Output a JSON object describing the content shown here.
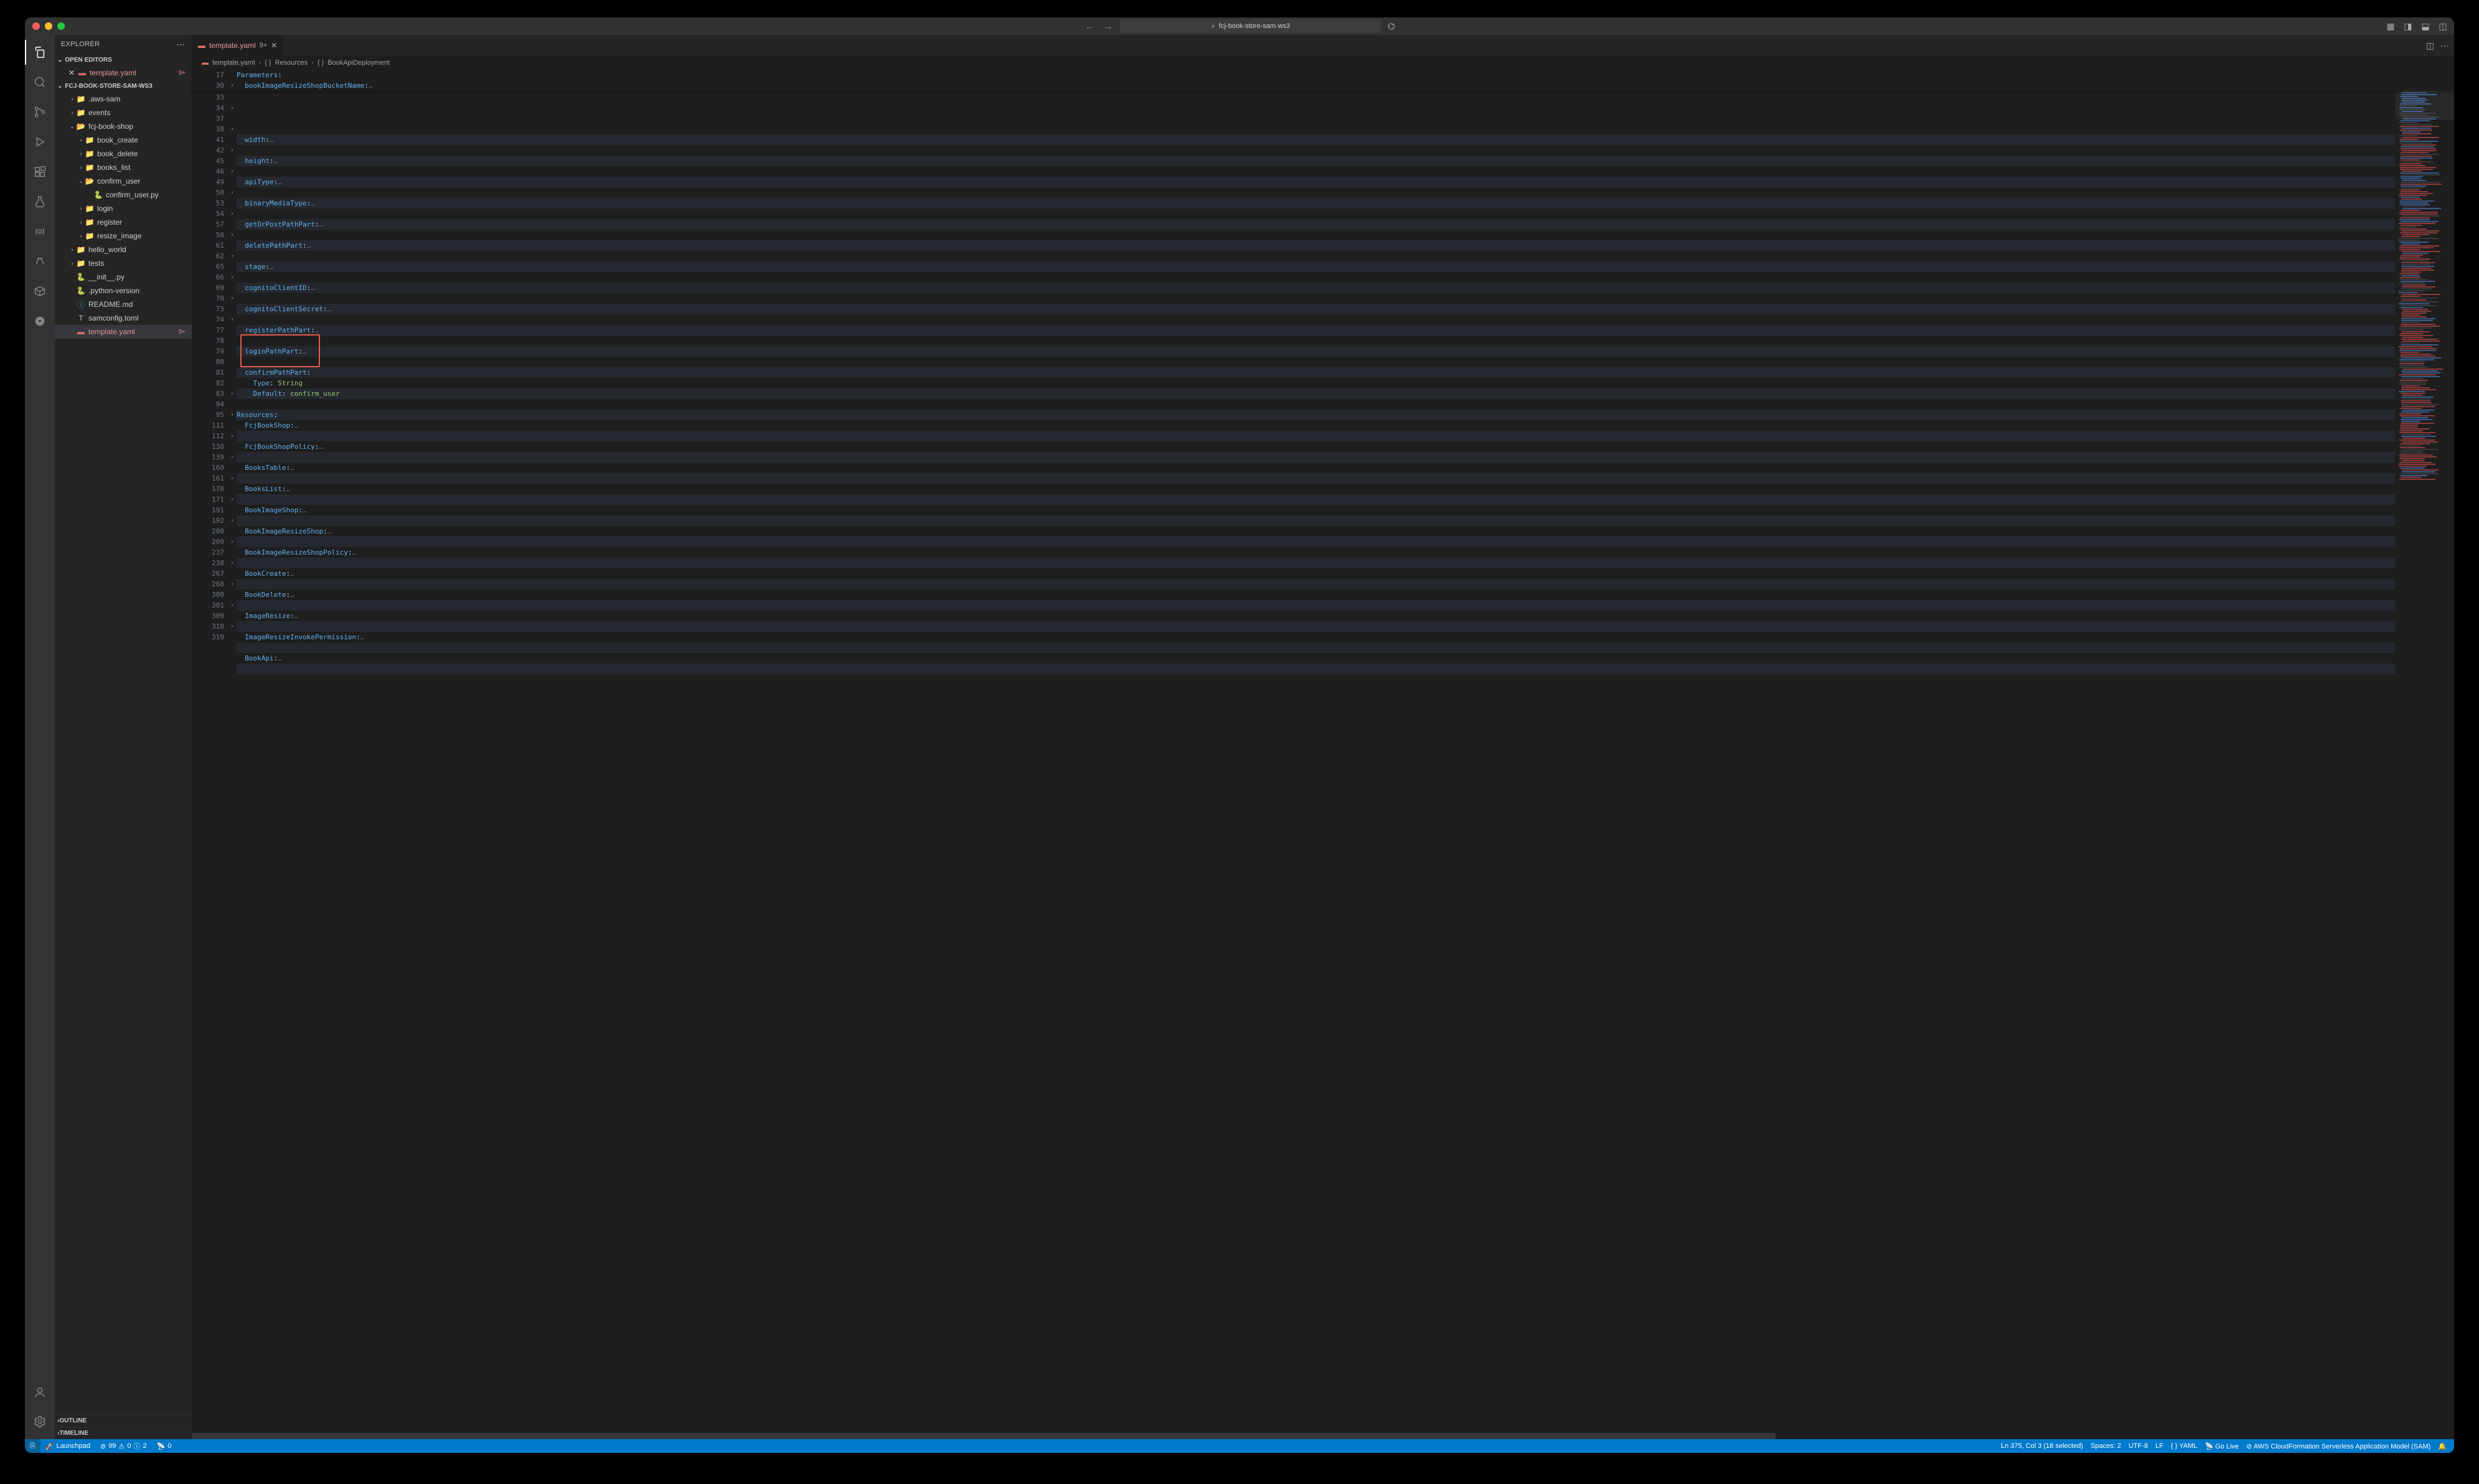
{
  "titlebar": {
    "search_text": "fcj-book-store-sam-ws3"
  },
  "sidebar": {
    "title": "EXPLORER",
    "open_editors_label": "OPEN EDITORS",
    "workspace_label": "FCJ-BOOK-STORE-SAM-WS3",
    "outline_label": "OUTLINE",
    "timeline_label": "TIMELINE",
    "open_editor": {
      "name": "template.yaml",
      "badge": "9+"
    },
    "tree": [
      {
        "depth": 1,
        "kind": "folder",
        "name": ".aws-sam",
        "tw": "›",
        "ico": "folder"
      },
      {
        "depth": 1,
        "kind": "folder",
        "name": "events",
        "tw": "›",
        "ico": "folder"
      },
      {
        "depth": 1,
        "kind": "folder",
        "name": "fcj-book-shop",
        "tw": "⌄",
        "ico": "folder-o"
      },
      {
        "depth": 2,
        "kind": "folder",
        "name": "book_create",
        "tw": "›",
        "ico": "folder"
      },
      {
        "depth": 2,
        "kind": "folder",
        "name": "book_delete",
        "tw": "›",
        "ico": "folder"
      },
      {
        "depth": 2,
        "kind": "folder",
        "name": "books_list",
        "tw": "›",
        "ico": "folder"
      },
      {
        "depth": 2,
        "kind": "folder",
        "name": "confirm_user",
        "tw": "⌄",
        "ico": "folder-o"
      },
      {
        "depth": 3,
        "kind": "file",
        "name": "confirm_user.py",
        "tw": "",
        "ico": "py"
      },
      {
        "depth": 2,
        "kind": "folder",
        "name": "login",
        "tw": "›",
        "ico": "folder"
      },
      {
        "depth": 2,
        "kind": "folder",
        "name": "register",
        "tw": "›",
        "ico": "folder"
      },
      {
        "depth": 2,
        "kind": "folder",
        "name": "resize_image",
        "tw": "›",
        "ico": "folder"
      },
      {
        "depth": 1,
        "kind": "folder",
        "name": "hello_world",
        "tw": "›",
        "ico": "folder"
      },
      {
        "depth": 1,
        "kind": "folder",
        "name": "tests",
        "tw": "›",
        "ico": "folder-teal"
      },
      {
        "depth": 1,
        "kind": "file",
        "name": "__init__.py",
        "tw": "",
        "ico": "py"
      },
      {
        "depth": 1,
        "kind": "file",
        "name": ".python-version",
        "tw": "",
        "ico": "py"
      },
      {
        "depth": 1,
        "kind": "file",
        "name": "README.md",
        "tw": "",
        "ico": "md"
      },
      {
        "depth": 1,
        "kind": "file",
        "name": "samconfig.toml",
        "tw": "",
        "ico": "toml"
      },
      {
        "depth": 1,
        "kind": "file",
        "name": "template.yaml",
        "tw": "",
        "ico": "yaml",
        "badge": "9+",
        "selected": true
      }
    ]
  },
  "tab": {
    "name": "template.yaml",
    "mod": "9+"
  },
  "breadcrumb": [
    {
      "ico": "yaml",
      "text": "template.yaml"
    },
    {
      "ico": "brace",
      "text": "Resources"
    },
    {
      "ico": "brace",
      "text": "BookApiDeployment"
    }
  ],
  "sticky": [
    {
      "num": "17",
      "fold": "",
      "content": "Parameters:",
      "cls": "key"
    },
    {
      "num": "30",
      "fold": "›",
      "content": "  bookImageResizeShopBucketName:…",
      "cls": "name"
    }
  ],
  "code_lines": [
    {
      "num": "33",
      "fold": "",
      "parts": []
    },
    {
      "num": "34",
      "fold": "›",
      "parts": [
        {
          "t": "  ",
          "c": ""
        },
        {
          "t": "width",
          "c": "tok-name"
        },
        {
          "t": ":",
          "c": "tok-punct"
        },
        {
          "t": "…",
          "c": "tok-ell"
        }
      ],
      "alt": true
    },
    {
      "num": "37",
      "fold": "",
      "parts": []
    },
    {
      "num": "38",
      "fold": "›",
      "parts": [
        {
          "t": "  ",
          "c": ""
        },
        {
          "t": "height",
          "c": "tok-name"
        },
        {
          "t": ":",
          "c": "tok-punct"
        },
        {
          "t": "…",
          "c": "tok-ell"
        }
      ],
      "alt": true
    },
    {
      "num": "41",
      "fold": "",
      "parts": []
    },
    {
      "num": "42",
      "fold": "›",
      "parts": [
        {
          "t": "  ",
          "c": ""
        },
        {
          "t": "apiType",
          "c": "tok-name"
        },
        {
          "t": ":",
          "c": "tok-punct"
        },
        {
          "t": "…",
          "c": "tok-ell"
        }
      ],
      "alt": true
    },
    {
      "num": "45",
      "fold": "",
      "parts": []
    },
    {
      "num": "46",
      "fold": "›",
      "parts": [
        {
          "t": "  ",
          "c": ""
        },
        {
          "t": "binaryMediaType",
          "c": "tok-name"
        },
        {
          "t": ":",
          "c": "tok-punct"
        },
        {
          "t": "…",
          "c": "tok-ell"
        }
      ],
      "alt": true
    },
    {
      "num": "49",
      "fold": "",
      "parts": []
    },
    {
      "num": "50",
      "fold": "›",
      "parts": [
        {
          "t": "  ",
          "c": ""
        },
        {
          "t": "getOrPostPathPart",
          "c": "tok-name"
        },
        {
          "t": ":",
          "c": "tok-punct"
        },
        {
          "t": "…",
          "c": "tok-ell"
        }
      ],
      "alt": true
    },
    {
      "num": "53",
      "fold": "",
      "parts": []
    },
    {
      "num": "54",
      "fold": "›",
      "parts": [
        {
          "t": "  ",
          "c": ""
        },
        {
          "t": "deletePathPart",
          "c": "tok-name"
        },
        {
          "t": ":",
          "c": "tok-punct"
        },
        {
          "t": "…",
          "c": "tok-ell"
        }
      ],
      "alt": true
    },
    {
      "num": "57",
      "fold": "",
      "parts": []
    },
    {
      "num": "58",
      "fold": "›",
      "parts": [
        {
          "t": "  ",
          "c": ""
        },
        {
          "t": "stage",
          "c": "tok-name"
        },
        {
          "t": ":",
          "c": "tok-punct"
        },
        {
          "t": "…",
          "c": "tok-ell"
        }
      ],
      "alt": true
    },
    {
      "num": "61",
      "fold": "",
      "parts": []
    },
    {
      "num": "62",
      "fold": "›",
      "parts": [
        {
          "t": "  ",
          "c": ""
        },
        {
          "t": "cognitoClientID",
          "c": "tok-name"
        },
        {
          "t": ":",
          "c": "tok-punct"
        },
        {
          "t": "…",
          "c": "tok-ell"
        }
      ],
      "alt": true
    },
    {
      "num": "65",
      "fold": "",
      "parts": []
    },
    {
      "num": "66",
      "fold": "›",
      "parts": [
        {
          "t": "  ",
          "c": ""
        },
        {
          "t": "cognitoClientSecret",
          "c": "tok-name"
        },
        {
          "t": ":",
          "c": "tok-punct"
        },
        {
          "t": "…",
          "c": "tok-ell"
        }
      ],
      "alt": true
    },
    {
      "num": "69",
      "fold": "",
      "parts": []
    },
    {
      "num": "70",
      "fold": "›",
      "parts": [
        {
          "t": "  ",
          "c": ""
        },
        {
          "t": "registerPathPart",
          "c": "tok-name"
        },
        {
          "t": ":",
          "c": "tok-punct"
        },
        {
          "t": "…",
          "c": "tok-ell"
        }
      ],
      "alt": true
    },
    {
      "num": "73",
      "fold": "",
      "parts": []
    },
    {
      "num": "74",
      "fold": "›",
      "parts": [
        {
          "t": "  ",
          "c": ""
        },
        {
          "t": "loginPathPart",
          "c": "tok-name"
        },
        {
          "t": ":",
          "c": "tok-punct"
        },
        {
          "t": "…",
          "c": "tok-ell"
        }
      ],
      "alt": true
    },
    {
      "num": "77",
      "fold": "",
      "parts": []
    },
    {
      "num": "78",
      "fold": "",
      "parts": [
        {
          "t": "  ",
          "c": ""
        },
        {
          "t": "confirmPathPart",
          "c": "tok-name"
        },
        {
          "t": ":",
          "c": "tok-punct"
        }
      ],
      "alt": true
    },
    {
      "num": "79",
      "fold": "",
      "parts": [
        {
          "t": "    ",
          "c": ""
        },
        {
          "t": "Type",
          "c": "tok-name"
        },
        {
          "t": ": ",
          "c": "tok-punct"
        },
        {
          "t": "String",
          "c": "tok-str"
        }
      ]
    },
    {
      "num": "80",
      "fold": "",
      "parts": [
        {
          "t": "    ",
          "c": ""
        },
        {
          "t": "Default",
          "c": "tok-name"
        },
        {
          "t": ": ",
          "c": "tok-punct"
        },
        {
          "t": "confirm_user",
          "c": "tok-str"
        }
      ],
      "alt": true
    },
    {
      "num": "81",
      "fold": "",
      "parts": []
    },
    {
      "num": "82",
      "fold": "",
      "parts": [
        {
          "t": "Resources",
          "c": "tok-key"
        },
        {
          "t": ":",
          "c": "tok-punct"
        }
      ],
      "alt": true
    },
    {
      "num": "83",
      "fold": "›",
      "parts": [
        {
          "t": "  ",
          "c": ""
        },
        {
          "t": "FcjBookShop",
          "c": "tok-name"
        },
        {
          "t": ":",
          "c": "tok-punct"
        },
        {
          "t": "…",
          "c": "tok-ell"
        }
      ]
    },
    {
      "num": "94",
      "fold": "",
      "parts": [],
      "alt": true
    },
    {
      "num": "95",
      "fold": "›",
      "parts": [
        {
          "t": "  ",
          "c": ""
        },
        {
          "t": "FcjBookShopPolicy",
          "c": "tok-name"
        },
        {
          "t": ":",
          "c": "tok-punct"
        },
        {
          "t": "…",
          "c": "tok-ell"
        }
      ]
    },
    {
      "num": "111",
      "fold": "",
      "parts": [],
      "alt": true
    },
    {
      "num": "112",
      "fold": "›",
      "parts": [
        {
          "t": "  ",
          "c": ""
        },
        {
          "t": "BooksTable",
          "c": "tok-name"
        },
        {
          "t": ":",
          "c": "tok-punct"
        },
        {
          "t": "…",
          "c": "tok-ell"
        }
      ]
    },
    {
      "num": "138",
      "fold": "",
      "parts": [],
      "alt": true
    },
    {
      "num": "139",
      "fold": "›",
      "parts": [
        {
          "t": "  ",
          "c": ""
        },
        {
          "t": "BooksList",
          "c": "tok-name"
        },
        {
          "t": ":",
          "c": "tok-punct"
        },
        {
          "t": "…",
          "c": "tok-ell"
        }
      ]
    },
    {
      "num": "160",
      "fold": "",
      "parts": [],
      "alt": true
    },
    {
      "num": "161",
      "fold": "›",
      "parts": [
        {
          "t": "  ",
          "c": ""
        },
        {
          "t": "BookImageShop",
          "c": "tok-name"
        },
        {
          "t": ":",
          "c": "tok-punct"
        },
        {
          "t": "…",
          "c": "tok-ell"
        }
      ]
    },
    {
      "num": "170",
      "fold": "",
      "parts": [],
      "alt": true
    },
    {
      "num": "171",
      "fold": "›",
      "parts": [
        {
          "t": "  ",
          "c": ""
        },
        {
          "t": "BookImageResizeShop",
          "c": "tok-name"
        },
        {
          "t": ":",
          "c": "tok-punct"
        },
        {
          "t": "…",
          "c": "tok-ell"
        }
      ]
    },
    {
      "num": "191",
      "fold": "",
      "parts": [],
      "alt": true
    },
    {
      "num": "192",
      "fold": "›",
      "parts": [
        {
          "t": "  ",
          "c": ""
        },
        {
          "t": "BookImageResizeShopPolicy",
          "c": "tok-name"
        },
        {
          "t": ":",
          "c": "tok-punct"
        },
        {
          "t": "…",
          "c": "tok-ell"
        }
      ]
    },
    {
      "num": "208",
      "fold": "",
      "parts": [],
      "alt": true
    },
    {
      "num": "209",
      "fold": "›",
      "parts": [
        {
          "t": "  ",
          "c": ""
        },
        {
          "t": "BookCreate",
          "c": "tok-name"
        },
        {
          "t": ":",
          "c": "tok-punct"
        },
        {
          "t": "…",
          "c": "tok-ell"
        }
      ]
    },
    {
      "num": "237",
      "fold": "",
      "parts": [],
      "alt": true
    },
    {
      "num": "238",
      "fold": "›",
      "parts": [
        {
          "t": "  ",
          "c": ""
        },
        {
          "t": "BookDelete",
          "c": "tok-name"
        },
        {
          "t": ":",
          "c": "tok-punct"
        },
        {
          "t": "…",
          "c": "tok-ell"
        }
      ]
    },
    {
      "num": "267",
      "fold": "",
      "parts": [],
      "alt": true
    },
    {
      "num": "268",
      "fold": "›",
      "parts": [
        {
          "t": "  ",
          "c": ""
        },
        {
          "t": "ImageResize",
          "c": "tok-name"
        },
        {
          "t": ":",
          "c": "tok-punct"
        },
        {
          "t": "…",
          "c": "tok-ell"
        }
      ]
    },
    {
      "num": "300",
      "fold": "",
      "parts": [],
      "alt": true
    },
    {
      "num": "301",
      "fold": "›",
      "parts": [
        {
          "t": "  ",
          "c": ""
        },
        {
          "t": "ImageResizeInvokePermission",
          "c": "tok-name"
        },
        {
          "t": ":",
          "c": "tok-punct"
        },
        {
          "t": "…",
          "c": "tok-ell"
        }
      ]
    },
    {
      "num": "309",
      "fold": "",
      "parts": [],
      "alt": true
    },
    {
      "num": "310",
      "fold": "›",
      "parts": [
        {
          "t": "  ",
          "c": ""
        },
        {
          "t": "BookApi",
          "c": "tok-name"
        },
        {
          "t": ":",
          "c": "tok-punct"
        },
        {
          "t": "…",
          "c": "tok-ell"
        }
      ]
    },
    {
      "num": "319",
      "fold": "",
      "parts": [],
      "alt": true
    }
  ],
  "statusbar": {
    "launchpad": "Launchpad",
    "diag": {
      "err": "99",
      "warn1": "0",
      "warn2": "2"
    },
    "ports": "0",
    "cursor": "Ln 375, Col 3 (18 selected)",
    "spaces": "Spaces: 2",
    "encoding": "UTF-8",
    "eol": "LF",
    "lang": "YAML",
    "golive": "Go Live",
    "sam": "AWS CloudFormation Serverless Application Model (SAM)"
  }
}
